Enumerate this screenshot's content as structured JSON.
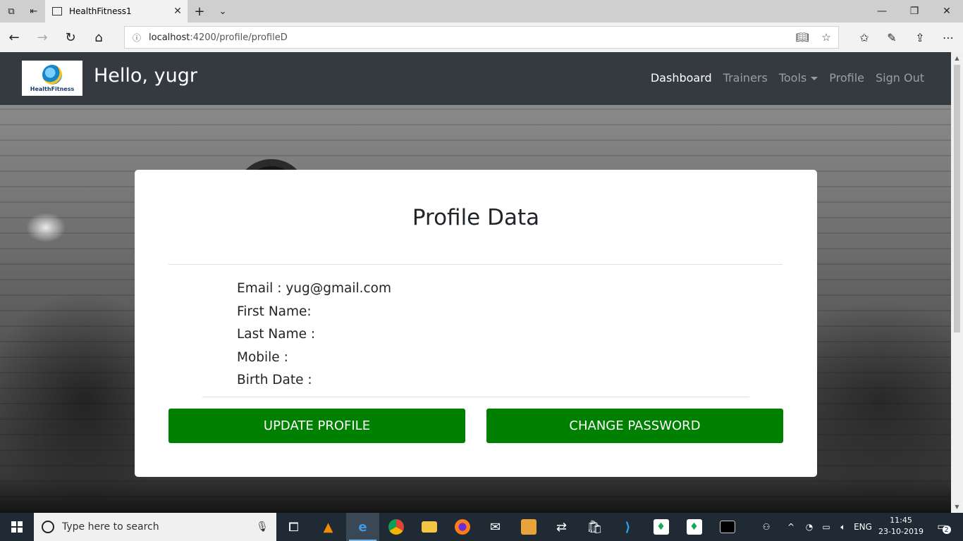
{
  "browser": {
    "tab_title": "HealthFitness1",
    "url_host": "localhost",
    "url_path": ":4200/profile/profileD"
  },
  "navbar": {
    "logo_text": "HealthFitness",
    "greeting": "Hello, yugr",
    "links": {
      "dashboard": "Dashboard",
      "trainers": "Trainers",
      "tools": "Tools",
      "profile": "Profile",
      "signout": "Sign Out"
    }
  },
  "profile": {
    "title": "Profile Data",
    "email": "Email : yug@gmail.com",
    "first_name": "First Name:",
    "last_name": "Last Name :",
    "mobile": "Mobile :",
    "birth_date": "Birth Date :",
    "update_button": "UPDATE PROFILE",
    "change_password_button": "CHANGE PASSWORD"
  },
  "taskbar": {
    "search_placeholder": "Type here to search",
    "language": "ENG",
    "time": "11:45",
    "date": "23-10-2019",
    "notification_count": "2"
  },
  "colors": {
    "navbar_bg": "#343a40",
    "button_green": "#008000",
    "taskbar_bg": "#1f2a35"
  }
}
